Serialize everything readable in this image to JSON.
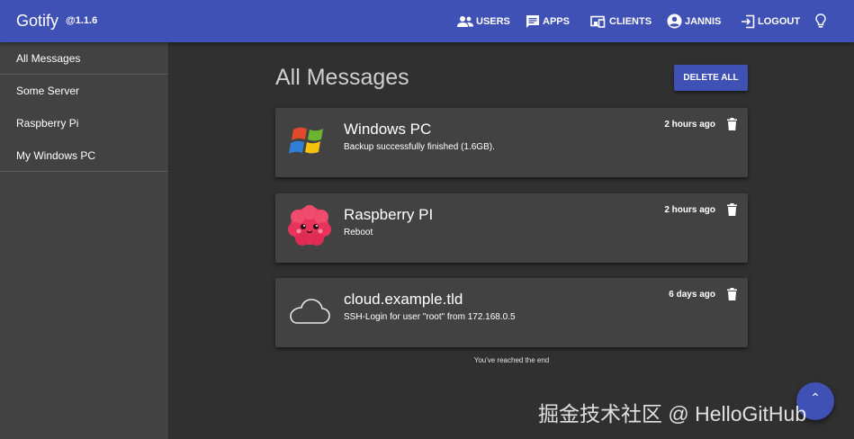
{
  "app": {
    "name": "Gotify",
    "version": "@1.1.6"
  },
  "nav": {
    "users": "USERS",
    "apps": "APPS",
    "clients": "CLIENTS",
    "user": "JANNIS",
    "logout": "LOGOUT"
  },
  "sidebar": {
    "items": [
      {
        "label": "All Messages"
      },
      {
        "label": "Some Server"
      },
      {
        "label": "Raspberry Pi"
      },
      {
        "label": "My Windows PC"
      }
    ]
  },
  "main": {
    "title": "All Messages",
    "delete_all_label": "DELETE ALL",
    "messages": [
      {
        "title": "Windows PC",
        "body": "Backup successfully finished (1.6GB).",
        "time": "2 hours ago",
        "icon": "windows-logo-icon"
      },
      {
        "title": "Raspberry PI",
        "body": "Reboot",
        "time": "2 hours ago",
        "icon": "raspberry-icon"
      },
      {
        "title": "cloud.example.tld",
        "body": "SSH-Login for user \"root\" from 172.168.0.5",
        "time": "6 days ago",
        "icon": "cloud-icon"
      }
    ],
    "end_text": "You've reached the end"
  },
  "fab": {
    "glyph": "⌃"
  },
  "watermark": "掘金技术社区 @ HelloGitHub",
  "colors": {
    "primary": "#3f51b5",
    "background": "#303030",
    "card": "#424242"
  }
}
